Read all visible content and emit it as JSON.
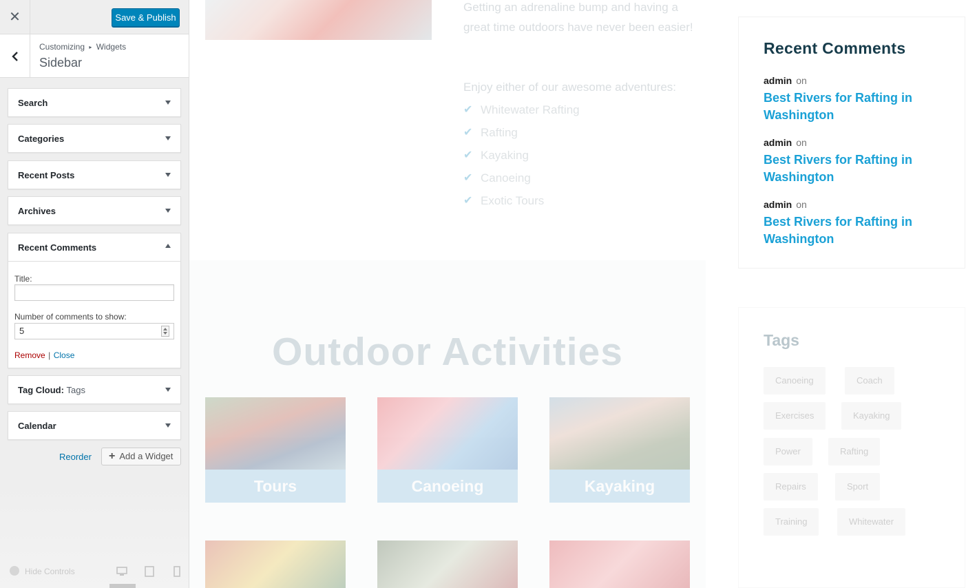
{
  "topbar": {
    "close_icon": "✕",
    "publish_label": "Save & Publish"
  },
  "section": {
    "back_icon": "‹",
    "crumb_root": "Customizing",
    "crumb_sep": "▸",
    "crumb_child": "Widgets",
    "title": "Sidebar"
  },
  "widgets": {
    "search": "Search",
    "categories": "Categories",
    "recent_posts": "Recent Posts",
    "archives": "Archives",
    "recent_comments": "Recent Comments",
    "tag_cloud": "Tag Cloud:",
    "tag_cloud_sub": "Tags",
    "calendar": "Calendar"
  },
  "recent_comments_form": {
    "title_label": "Title:",
    "title_value": "",
    "number_label": "Number of comments to show:",
    "number_value": "5",
    "remove_label": "Remove",
    "separator": "|",
    "close_label": "Close"
  },
  "actions": {
    "reorder_label": "Reorder",
    "add_icon": "+",
    "add_label": "Add a Widget"
  },
  "footer": {
    "hide_controls_label": "Hide Controls"
  },
  "preview": {
    "hero_p1": "Getting an adrenaline bump and having a great time outdoors have never been easier!",
    "hero_p2": "Enjoy either of our awesome adventures:",
    "check_icon": "✔",
    "check_items": [
      "Whitewater Rafting",
      "Rafting",
      "Kayaking",
      "Canoeing",
      "Exotic Tours"
    ],
    "activities_title": "Outdoor Activities",
    "cards": [
      "Tours",
      "Canoeing",
      "Kayaking"
    ],
    "recent_comments": {
      "title": "Recent Comments",
      "items": [
        {
          "author": "admin",
          "on": "on",
          "post": "Best Rivers for Rafting in Washington"
        },
        {
          "author": "admin",
          "on": "on",
          "post": "Best Rivers for Rafting in Washington"
        },
        {
          "author": "admin",
          "on": "on",
          "post": "Best Rivers for Rafting in Washington"
        }
      ]
    },
    "tags": {
      "title": "Tags",
      "items": [
        "Canoeing",
        "Coach",
        "Exercises",
        "Kayaking",
        "Power",
        "Rafting",
        "Repairs",
        "Sport",
        "Training",
        "Whitewater"
      ]
    }
  },
  "colors": {
    "primary_button": "#0085ba",
    "link": "#0073aa",
    "remove": "#aa0000",
    "comment_link": "#1aa1d6",
    "heading": "#173c4b"
  }
}
